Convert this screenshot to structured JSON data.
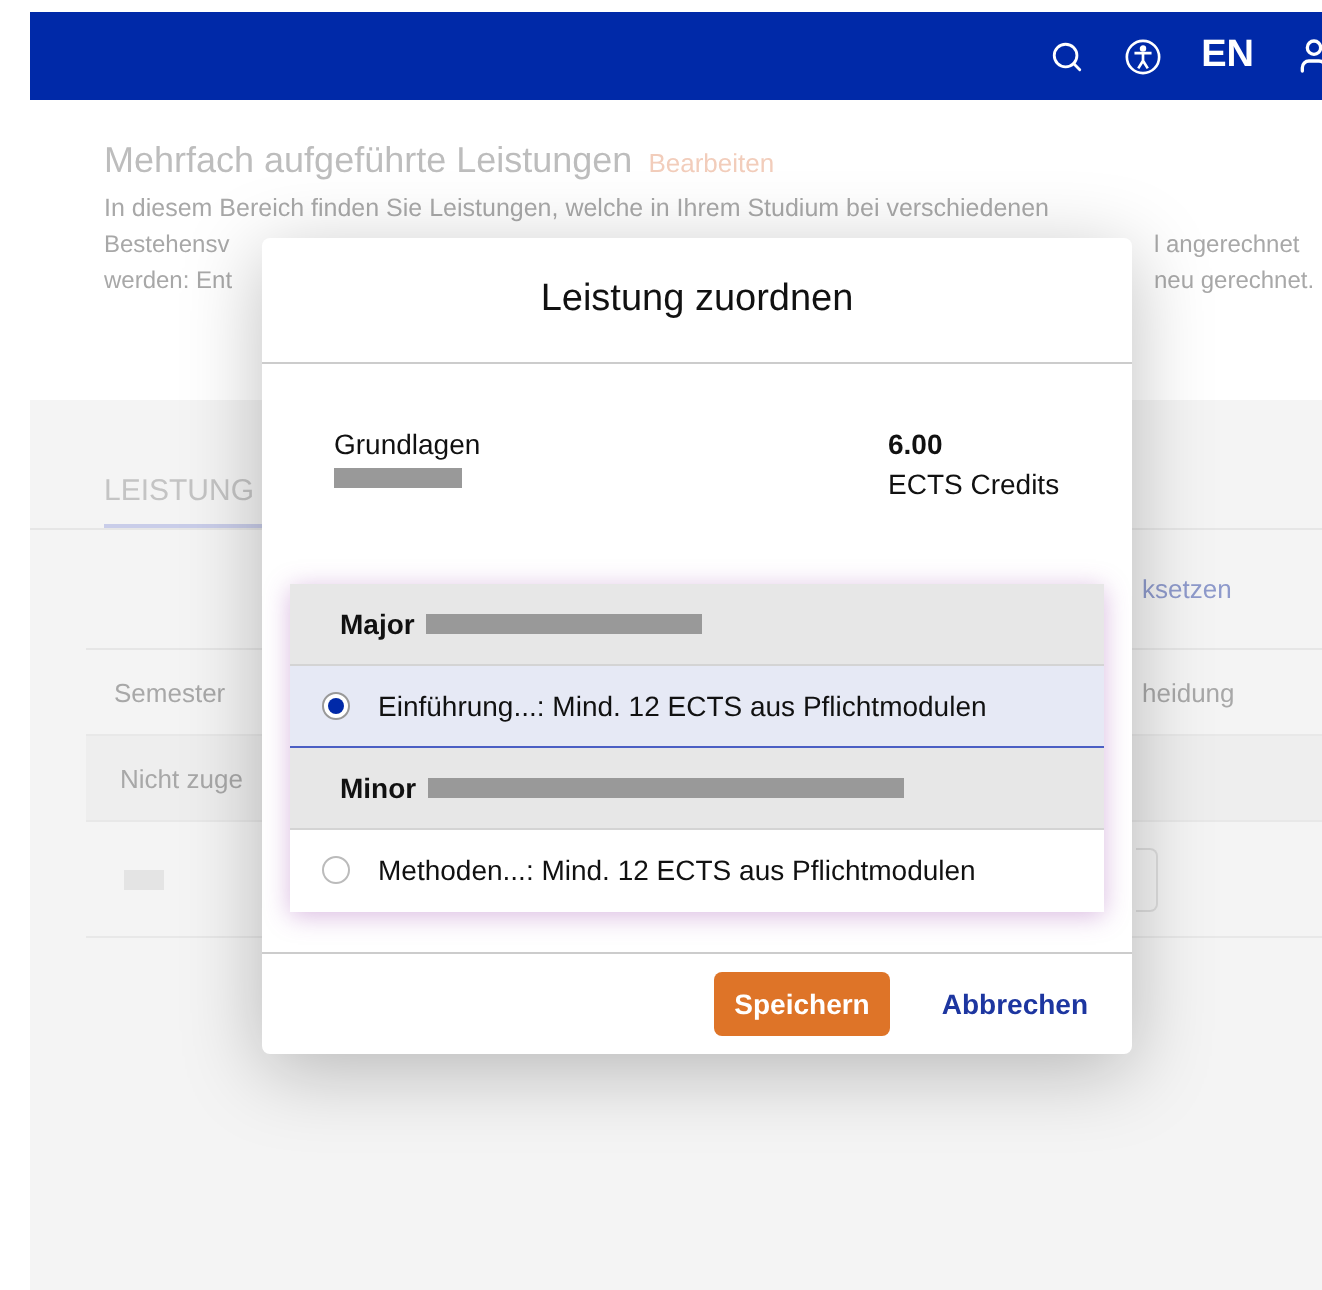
{
  "header": {
    "language": "EN"
  },
  "background": {
    "title": "Mehrfach aufgeführte Leistungen",
    "edit_link": "Bearbeiten",
    "intro_line": "In diesem Bereich finden Sie Leistungen, welche in Ihrem Studium bei verschiedenen",
    "fragments_left": [
      "Bestehensv",
      "werden: Ent"
    ],
    "fragments_right": [
      "l angerechnet",
      "neu gerechnet."
    ],
    "tab": "LEISTUNG",
    "reset_link_fragment": "ksetzen",
    "column_left": "Semester",
    "column_right": "heidung",
    "row_label": "Nicht zuge"
  },
  "dialog": {
    "title": "Leistung zuordnen",
    "course": "Grundlagen",
    "credits": "6.00",
    "credits_unit": "ECTS Credits",
    "groups": [
      {
        "label": "Major",
        "options": [
          {
            "label": "Einführung...: Mind. 12 ECTS aus Pflichtmodulen",
            "selected": true
          }
        ]
      },
      {
        "label": "Minor",
        "options": [
          {
            "label": "Methoden...: Mind. 12 ECTS aus Pflichtmodulen",
            "selected": false
          }
        ]
      }
    ],
    "buttons": {
      "save": "Speichern",
      "cancel": "Abbrechen"
    }
  }
}
